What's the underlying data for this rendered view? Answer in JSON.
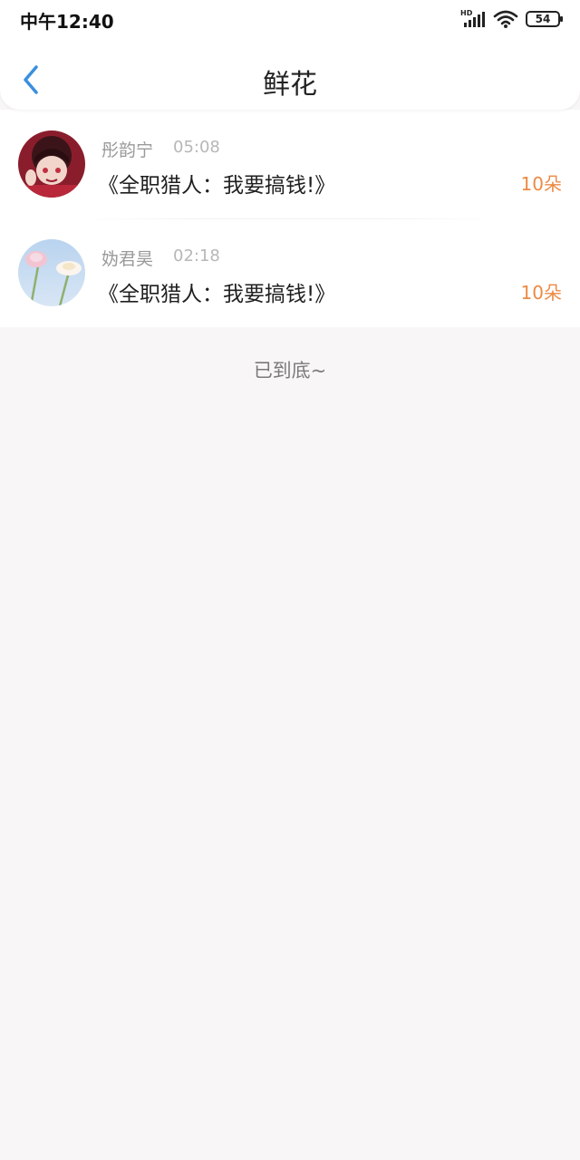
{
  "status_bar": {
    "time": "中午12:40",
    "network_label": "HD",
    "battery_level": "54",
    "icons": [
      "signal-icon",
      "wifi-icon",
      "battery-icon"
    ]
  },
  "header": {
    "title": "鲜花",
    "back_icon": "chevron-left-icon",
    "accent_color": "#3a8fe0"
  },
  "records": [
    {
      "name": "彤韵宁",
      "time": "05:08",
      "book": "《全职猎人：我要搞钱!》",
      "count": "10朵"
    },
    {
      "name": "妫君昊",
      "time": "02:18",
      "book": "《全职猎人：我要搞钱!》",
      "count": "10朵"
    }
  ],
  "footer_text": "已到底~",
  "colors": {
    "count": "#ec8a45",
    "background": "#f8f6f7"
  }
}
